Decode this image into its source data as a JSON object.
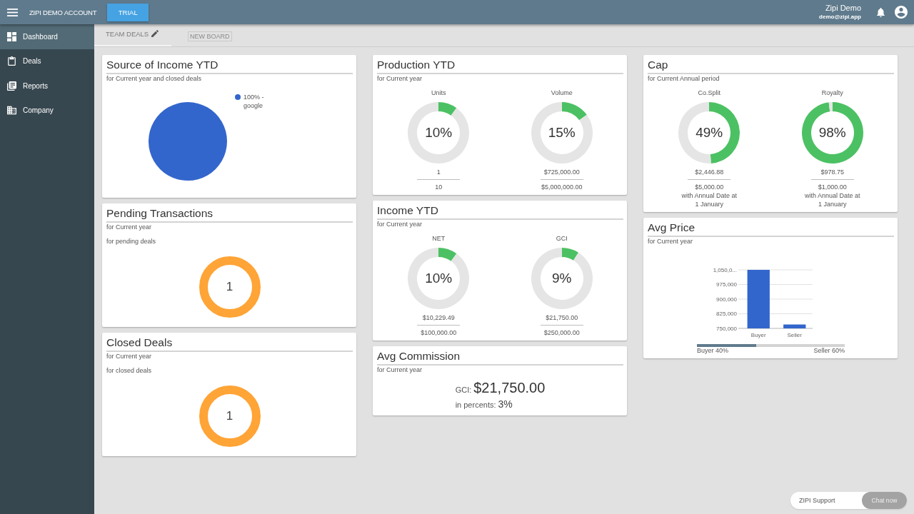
{
  "top_bar": {
    "account_name": "ZIPI DEMO ACCOUNT",
    "plan_button": "TRIAL",
    "user_name": "Zipi Demo",
    "user_email": "demo@zipi.app"
  },
  "sidebar": {
    "items": [
      {
        "label": "Dashboard",
        "selected": true
      },
      {
        "label": "Deals",
        "selected": false
      },
      {
        "label": "Reports",
        "selected": false
      },
      {
        "label": "Company",
        "selected": false
      }
    ]
  },
  "board_tabs": [
    {
      "label": "TEAM DEALS",
      "selected": true
    }
  ],
  "new_board_button": "NEW BOARD",
  "columns": [
    {
      "cards": [
        {
          "kind": "pie",
          "title": "Source of Income YTD",
          "subtitle": "for Current year and closed deals",
          "chart_data": {
            "type": "pie",
            "categories": [
              "100% - google"
            ],
            "values": [
              100
            ],
            "colors": [
              "#3366cc"
            ],
            "legend": "right"
          }
        },
        {
          "kind": "count",
          "title": "Pending Transactions",
          "subtitle": "for Current year",
          "note": "for pending deals",
          "count": "1"
        },
        {
          "kind": "count",
          "title": "Closed Deals",
          "subtitle": "for Current year",
          "note": "for closed deals",
          "count": "1"
        }
      ]
    },
    {
      "cards": [
        {
          "kind": "gauges",
          "title": "Production YTD",
          "subtitle": "for Current year",
          "gauges": [
            {
              "label": "Units",
              "percent": "10%",
              "value": "1",
              "total": "10",
              "chart_data": {
                "type": "donut",
                "values": [
                  10,
                  90
                ],
                "colors": [
                  "#4cc163",
                  "#e5e5e5"
                ]
              }
            },
            {
              "label": "Volume",
              "percent": "15%",
              "value": "$725,000.00",
              "total": "$5,000,000.00",
              "chart_data": {
                "type": "donut",
                "values": [
                  15,
                  85
                ],
                "colors": [
                  "#4cc163",
                  "#e5e5e5"
                ]
              }
            }
          ]
        },
        {
          "kind": "gauges",
          "title": "Income YTD",
          "subtitle": "for Current year",
          "gauges": [
            {
              "label": "NET",
              "percent": "10%",
              "value": "$10,229.49",
              "total": "$100,000.00",
              "chart_data": {
                "type": "donut",
                "values": [
                  10,
                  90
                ],
                "colors": [
                  "#4cc163",
                  "#e5e5e5"
                ]
              }
            },
            {
              "label": "GCI",
              "percent": "9%",
              "value": "$21,750.00",
              "total": "$250,000.00",
              "chart_data": {
                "type": "donut",
                "values": [
                  9,
                  91
                ],
                "colors": [
                  "#4cc163",
                  "#e5e5e5"
                ]
              }
            }
          ]
        },
        {
          "kind": "commission",
          "title": "Avg Commission",
          "subtitle": "for Current year",
          "gci_label": "GCI:",
          "gci_value": "$21,750.00",
          "percent_label": "in percents:",
          "percent_value": "3%"
        }
      ]
    },
    {
      "cards": [
        {
          "kind": "gauges",
          "title": "Cap",
          "subtitle": "for Current Annual period",
          "gauges": [
            {
              "label": "Co.Split",
              "percent": "49%",
              "value": "$2,446.88",
              "total": "$5,000.00",
              "note": "with Annual Date at 1 January",
              "chart_data": {
                "type": "donut",
                "values": [
                  49,
                  51
                ],
                "colors": [
                  "#4cc163",
                  "#e5e5e5"
                ]
              }
            },
            {
              "label": "Royalty",
              "percent": "98%",
              "value": "$978.75",
              "total": "$1,000.00",
              "note": "with Annual Date at 1 January",
              "chart_data": {
                "type": "donut",
                "values": [
                  98,
                  2
                ],
                "colors": [
                  "#4cc163",
                  "#e5e5e5"
                ]
              }
            }
          ]
        },
        {
          "kind": "bar",
          "title": "Avg Price",
          "subtitle": "for Current year",
          "chart_data": {
            "type": "bar",
            "categories": [
              "Buyer",
              "Seller"
            ],
            "values": [
              1050000,
              770000
            ],
            "color": "#3366cc",
            "ylim": [
              750000,
              1050000
            ],
            "yticks": [
              {
                "value": 750000,
                "label": "750,000"
              },
              {
                "value": 825000,
                "label": "825,000"
              },
              {
                "value": 900000,
                "label": "900,000"
              },
              {
                "value": 975000,
                "label": "975,000"
              },
              {
                "value": 1050000,
                "label": "1,050,0..."
              }
            ],
            "grid": true
          },
          "split": {
            "level": 0.4,
            "left_label": "Buyer 40%",
            "right_label": "Seller 60%"
          }
        }
      ]
    }
  ],
  "chat_widget": {
    "label": "ZIPI Support",
    "button": "Chat now"
  }
}
